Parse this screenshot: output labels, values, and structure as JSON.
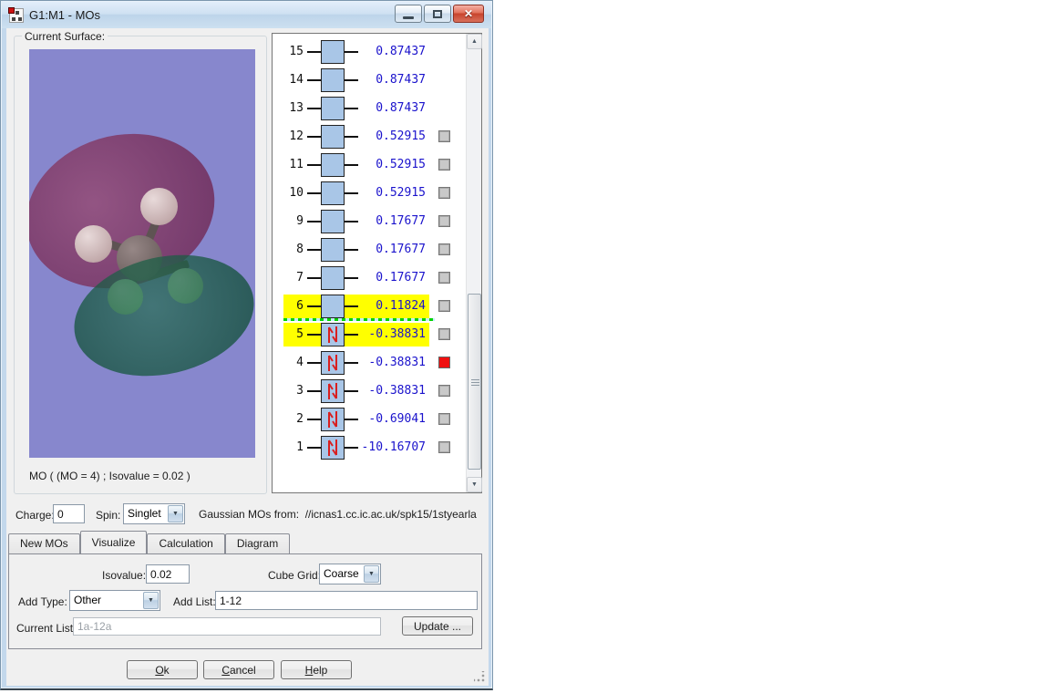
{
  "window": {
    "title": "G1:M1 - MOs"
  },
  "surface_panel": {
    "group_label": "Current Surface:",
    "caption": "MO ( (MO = 4) ; Isovalue = 0.02 )",
    "viewport_colors": {
      "background": "#8787cd",
      "positive_lobe": "#7a4060",
      "negative_lobe": "#2f6e57",
      "carbon": "#7b6d6c",
      "hydrogen": "#d3c0c0",
      "hydrogen_tinted": "#b2dcaa"
    }
  },
  "mo_list": {
    "rows": [
      {
        "index": 15,
        "energy": "0.87437",
        "occupied": false,
        "checkbox": "none",
        "highlight": false
      },
      {
        "index": 14,
        "energy": "0.87437",
        "occupied": false,
        "checkbox": "none",
        "highlight": false
      },
      {
        "index": 13,
        "energy": "0.87437",
        "occupied": false,
        "checkbox": "none",
        "highlight": false
      },
      {
        "index": 12,
        "energy": "0.52915",
        "occupied": false,
        "checkbox": "normal",
        "highlight": false
      },
      {
        "index": 11,
        "energy": "0.52915",
        "occupied": false,
        "checkbox": "normal",
        "highlight": false
      },
      {
        "index": 10,
        "energy": "0.52915",
        "occupied": false,
        "checkbox": "normal",
        "highlight": false
      },
      {
        "index": 9,
        "energy": "0.17677",
        "occupied": false,
        "checkbox": "normal",
        "highlight": false
      },
      {
        "index": 8,
        "energy": "0.17677",
        "occupied": false,
        "checkbox": "normal",
        "highlight": false
      },
      {
        "index": 7,
        "energy": "0.17677",
        "occupied": false,
        "checkbox": "normal",
        "highlight": false
      },
      {
        "index": 6,
        "energy": "0.11824",
        "occupied": false,
        "checkbox": "normal",
        "highlight": true
      },
      {
        "index": 5,
        "energy": "-0.38831",
        "occupied": true,
        "checkbox": "normal",
        "highlight": true
      },
      {
        "index": 4,
        "energy": "-0.38831",
        "occupied": true,
        "checkbox": "selected",
        "highlight": false
      },
      {
        "index": 3,
        "energy": "-0.38831",
        "occupied": true,
        "checkbox": "normal",
        "highlight": false
      },
      {
        "index": 2,
        "energy": "-0.69041",
        "occupied": true,
        "checkbox": "normal",
        "highlight": false
      },
      {
        "index": 1,
        "energy": "-10.16707",
        "occupied": true,
        "checkbox": "normal",
        "highlight": false
      }
    ],
    "divider_between": [
      6,
      5
    ],
    "colors": {
      "highlight": "#ffff00",
      "divider_green": "#00d400",
      "energy_text": "#1a12cc",
      "selected_checkbox": "#f01010",
      "orbital_box": "#a9c6e7"
    }
  },
  "settings": {
    "charge_label": "Charge:",
    "charge_value": "0",
    "spin_label": "Spin:",
    "spin_value": "Singlet",
    "source_label": "Gaussian MOs from:",
    "source_path": "//icnas1.cc.ic.ac.uk/spk15/1styearla"
  },
  "tabs": [
    {
      "label": "New MOs",
      "active": false
    },
    {
      "label": "Visualize",
      "active": true
    },
    {
      "label": "Calculation",
      "active": false
    },
    {
      "label": "Diagram",
      "active": false
    }
  ],
  "visualize_tab": {
    "isovalue_label": "Isovalue:",
    "isovalue_value": "0.02",
    "cube_grid_label": "Cube Grid:",
    "cube_grid_value": "Coarse",
    "add_type_label": "Add Type:",
    "add_type_value": "Other",
    "add_list_label": "Add List:",
    "add_list_value": "1-12",
    "current_list_label": "Current List:",
    "current_list_value": "1a-12a",
    "update_button": "Update ..."
  },
  "footer": {
    "ok": "Ok",
    "cancel": "Cancel",
    "help": "Help"
  }
}
